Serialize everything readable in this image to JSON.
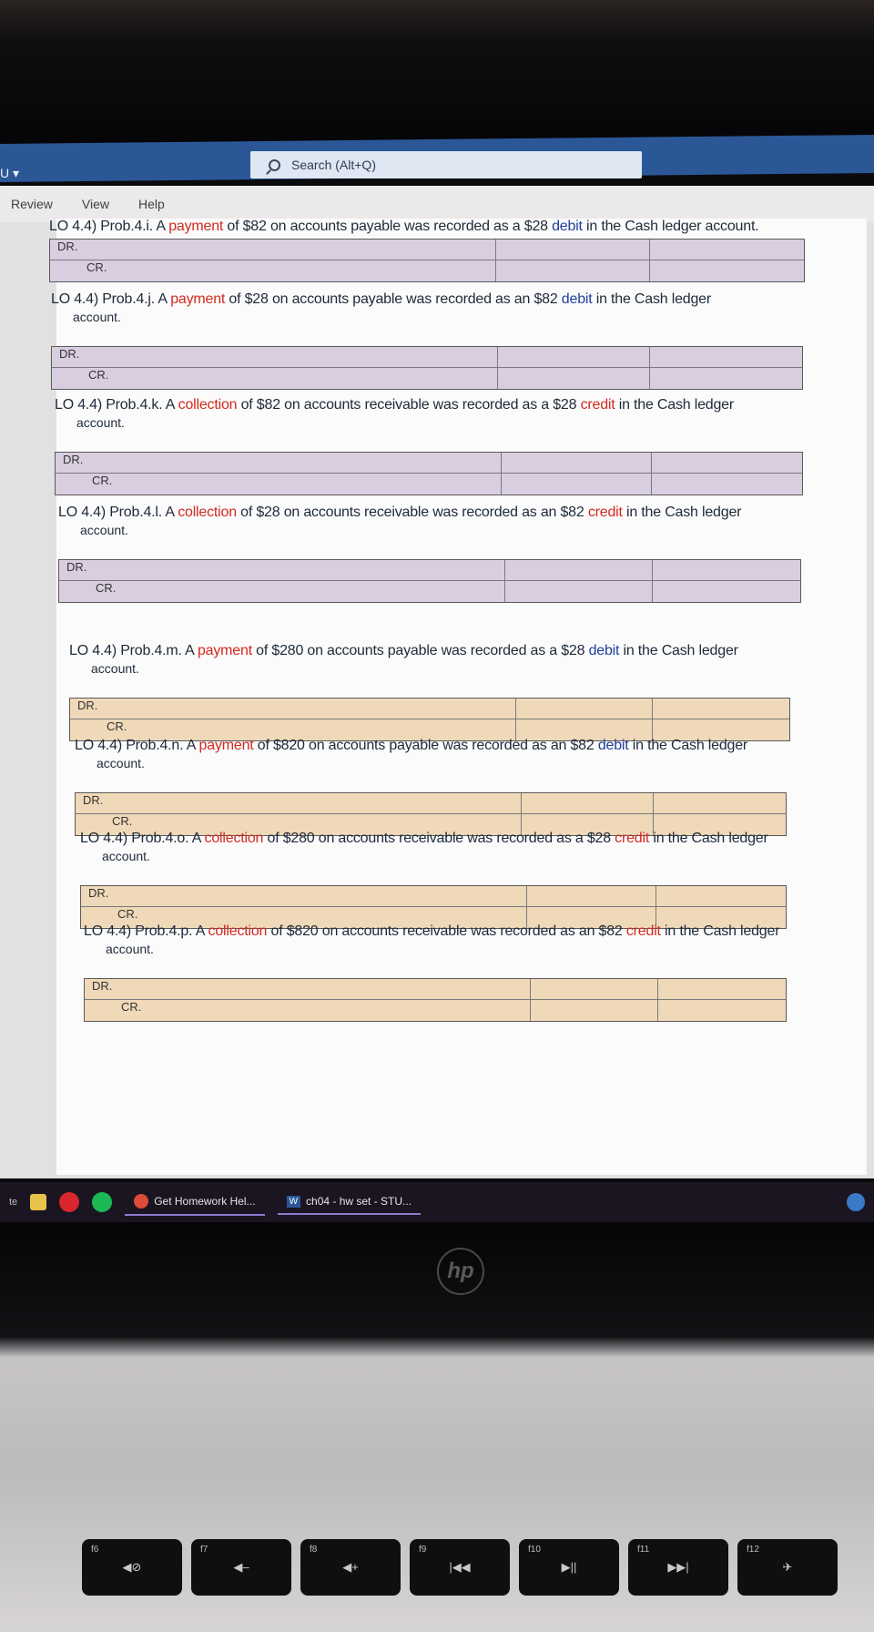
{
  "titlebar": {
    "quick_access": "U ▾",
    "search_placeholder": "Search (Alt+Q)"
  },
  "ribbon": {
    "tabs": [
      "Review",
      "View",
      "Help"
    ]
  },
  "problems": [
    {
      "prefix": "LO 4.4) Prob.4.i. A ",
      "action": "payment",
      "middle": " of $82 on accounts payable was recorded as a $28 ",
      "entry": "debit",
      "suffix": " in the Cash ledger account.",
      "line2": "",
      "color": "purple"
    },
    {
      "prefix": "LO 4.4) Prob.4.j. A ",
      "action": "payment",
      "middle": " of $28 on accounts payable was recorded as an $82 ",
      "entry": "debit",
      "suffix": " in the Cash ledger",
      "line2": "account.",
      "color": "purple"
    },
    {
      "prefix": "LO 4.4) Prob.4.k. A ",
      "action": "collection",
      "middle": " of $82 on accounts receivable was recorded as a $28 ",
      "entry": "credit",
      "suffix": " in the Cash ledger",
      "line2": "account.",
      "color": "purple"
    },
    {
      "prefix": "LO 4.4) Prob.4.l. A ",
      "action": "collection",
      "middle": " of $28 on accounts receivable was recorded as an $82 ",
      "entry": "credit",
      "suffix": " in the Cash ledger",
      "line2": "account.",
      "color": "purple"
    },
    {
      "prefix": "LO 4.4) Prob.4.m. A ",
      "action": "payment",
      "middle": " of $280 on accounts payable was recorded as a $28 ",
      "entry": "debit",
      "suffix": " in the Cash ledger",
      "line2": "account.",
      "color": "tan"
    },
    {
      "prefix": "LO 4.4) Prob.4.n. A ",
      "action": "payment",
      "middle": " of $820 on accounts payable was recorded as an $82 ",
      "entry": "debit",
      "suffix": " in the Cash ledger",
      "line2": "account.",
      "color": "tan"
    },
    {
      "prefix": "LO 4.4) Prob.4.o. A ",
      "action": "collection",
      "middle": " of $280 on accounts receivable was recorded as a $28 ",
      "entry": "credit",
      "suffix": " in the Cash ledger",
      "line2": "account.",
      "color": "tan"
    },
    {
      "prefix": "LO 4.4) Prob.4.p. A ",
      "action": "collection",
      "middle": " of $820 on accounts receivable was recorded as an $82 ",
      "entry": "credit",
      "suffix": " in the Cash ledger",
      "line2": "account.",
      "color": "tan"
    }
  ],
  "grid_labels": {
    "dr": "DR.",
    "cr": "CR."
  },
  "taskbar": {
    "tasks": [
      "Get Homework Hel...",
      "ch04 - hw set - STU..."
    ],
    "left_label": "te"
  },
  "laptop": {
    "logo": "hp",
    "keys": [
      {
        "fn": "f6",
        "label": "◀⊘"
      },
      {
        "fn": "f7",
        "label": "◀–"
      },
      {
        "fn": "f8",
        "label": "◀+"
      },
      {
        "fn": "f9",
        "label": "|◀◀"
      },
      {
        "fn": "f10",
        "label": "▶||"
      },
      {
        "fn": "f11",
        "label": "▶▶|"
      },
      {
        "fn": "f12",
        "label": "✈"
      }
    ]
  }
}
